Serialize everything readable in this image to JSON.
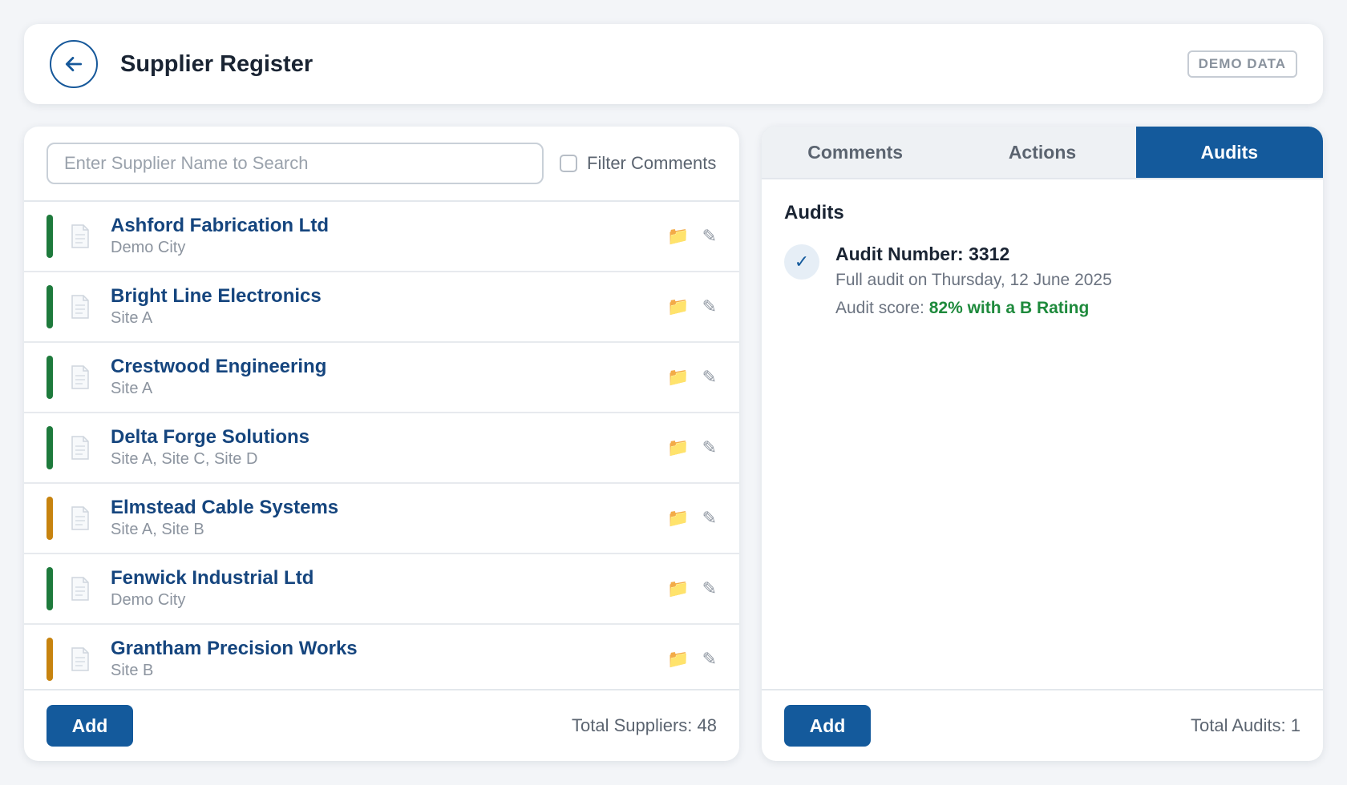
{
  "header": {
    "title": "Supplier Register",
    "badge": "DEMO DATA",
    "back_icon": "arrow-left-icon"
  },
  "colors": {
    "primary": "#145a9c",
    "status_green": "#1e7a3c",
    "status_amber": "#c7830f",
    "score_green": "#1e8a3c"
  },
  "search": {
    "placeholder": "Enter Supplier Name to Search",
    "value": "",
    "filter_label": "Filter Comments",
    "filter_checked": false
  },
  "suppliers": [
    {
      "name": "Ashford Fabrication Ltd",
      "site": "Demo City",
      "status": "green"
    },
    {
      "name": "Bright Line Electronics",
      "site": "Site A",
      "status": "green"
    },
    {
      "name": "Crestwood Engineering",
      "site": "Site A",
      "status": "green"
    },
    {
      "name": "Delta Forge Solutions",
      "site": "Site A, Site C, Site D",
      "status": "green"
    },
    {
      "name": "Elmstead Cable Systems",
      "site": "Site A, Site B",
      "status": "amber"
    },
    {
      "name": "Fenwick Industrial Ltd",
      "site": "Demo City",
      "status": "green"
    },
    {
      "name": "Grantham Precision Works",
      "site": "Site B",
      "status": "amber"
    }
  ],
  "left_footer": {
    "add_label": "Add",
    "total_label": "Total Suppliers: 48"
  },
  "tabs": [
    {
      "label": "Comments",
      "active": false
    },
    {
      "label": "Actions",
      "active": false
    },
    {
      "label": "Audits",
      "active": true
    }
  ],
  "audits": {
    "heading": "Audits",
    "items": [
      {
        "number_label": "Audit Number: 3312",
        "description": "Full audit on Thursday, 12 June 2025",
        "score_prefix": "Audit score: ",
        "score": "82% with a B Rating"
      }
    ]
  },
  "right_footer": {
    "add_label": "Add",
    "total_label": "Total Audits: 1"
  }
}
